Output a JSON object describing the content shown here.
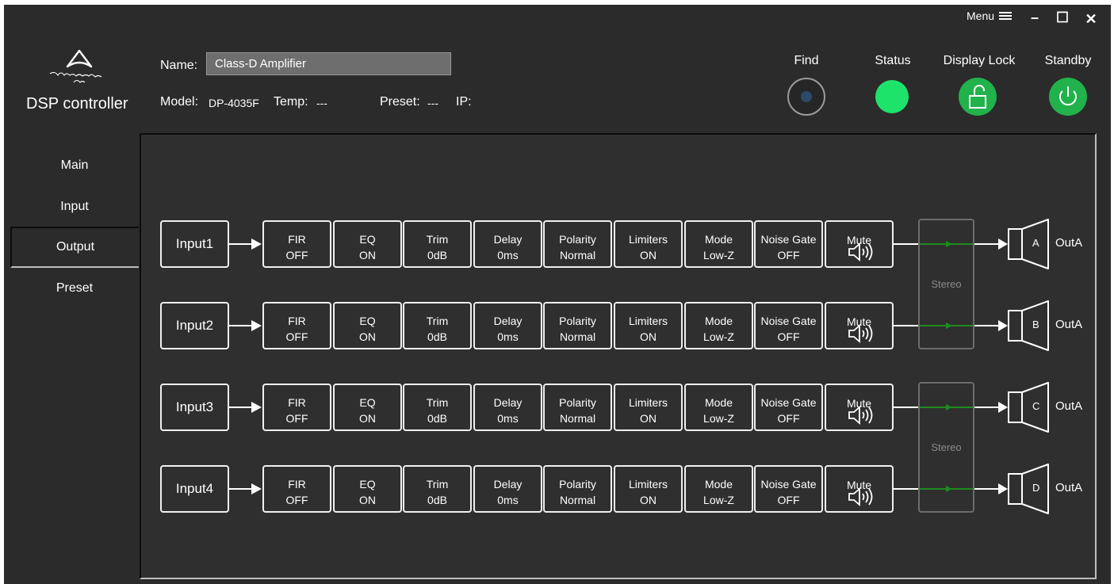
{
  "window": {
    "menu_label": "Menu",
    "minimize": "–",
    "maximize": "☐",
    "close": "✕"
  },
  "app": {
    "title": "DSP controller"
  },
  "device": {
    "name_label": "Name:",
    "name_value": "Class-D Amplifier",
    "model_label": "Model:",
    "model_value": "DP-4035F",
    "temp_label": "Temp:",
    "temp_value": "---",
    "preset_label": "Preset:",
    "preset_value": "---",
    "ip_label": "IP:"
  },
  "controls": {
    "find": "Find",
    "status": "Status",
    "display_lock": "Display Lock",
    "standby": "Standby",
    "status_color": "#1de36a",
    "lock_color": "#22b24c",
    "standby_color": "#22b24c"
  },
  "tabs": [
    {
      "label": "Main"
    },
    {
      "label": "Input"
    },
    {
      "label": "Output",
      "active": true
    },
    {
      "label": "Preset"
    }
  ],
  "channels": [
    {
      "input": "Input1",
      "speaker": "A",
      "out": "OutA"
    },
    {
      "input": "Input2",
      "speaker": "B",
      "out": "OutA"
    },
    {
      "input": "Input3",
      "speaker": "C",
      "out": "OutA"
    },
    {
      "input": "Input4",
      "speaker": "D",
      "out": "OutA"
    }
  ],
  "blocks": [
    {
      "name": "FIR",
      "value": "OFF"
    },
    {
      "name": "EQ",
      "value": "ON"
    },
    {
      "name": "Trim",
      "value": "0dB"
    },
    {
      "name": "Delay",
      "value": "0ms"
    },
    {
      "name": "Polarity",
      "value": "Normal"
    },
    {
      "name": "Limiters",
      "value": "ON"
    },
    {
      "name": "Mode",
      "value": "Low-Z"
    },
    {
      "name": "Noise Gate",
      "value": "OFF"
    }
  ],
  "mute_label": "Mute",
  "stereo_label": "Stereo"
}
